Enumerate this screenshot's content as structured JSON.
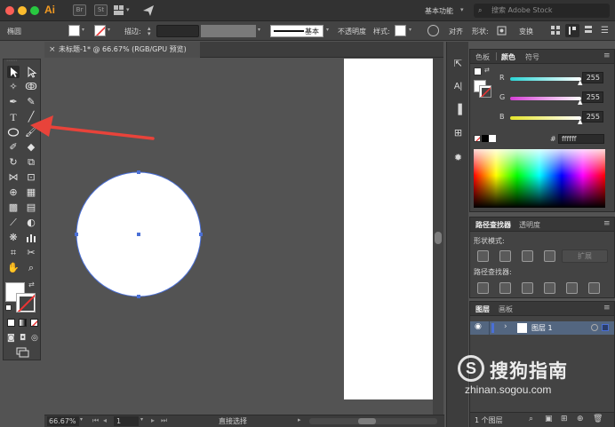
{
  "app": {
    "logo": "Ai",
    "bridge_label": "Br",
    "stock_label": "St",
    "workspace": "基本功能",
    "search_placeholder": "搜索 Adobe Stock"
  },
  "control_bar": {
    "object_type": "椭圆",
    "stroke_label": "描边:",
    "stroke_profile": "基本",
    "opacity_label": "不透明度",
    "style_label": "样式:",
    "align_label": "对齐",
    "shape_label": "形状:",
    "transform_label": "变换"
  },
  "document": {
    "tab_title": "未标题-1* @ 66.67% (RGB/GPU 预览)",
    "close_glyph": "×"
  },
  "status_bar": {
    "zoom": "66.67%",
    "artboard_number": "1",
    "current_tool": "直接选择"
  },
  "color_panel": {
    "tabs": [
      "色板",
      "颜色",
      "符号"
    ],
    "active_tab": "颜色",
    "channels": [
      {
        "name": "R",
        "value": "255",
        "color": "#ff4a4a"
      },
      {
        "name": "G",
        "value": "255",
        "color": "#48e04f"
      },
      {
        "name": "B",
        "value": "255",
        "color": "#4f6cf5"
      }
    ],
    "hex_label": "#",
    "hex_value": "ffffff"
  },
  "pathfinder_panel": {
    "tabs": [
      "路径查找器",
      "透明度"
    ],
    "shape_modes_label": "形状模式:",
    "expand_label": "扩展",
    "pathfinders_label": "路径查找器:"
  },
  "layers_panel": {
    "tabs": [
      "图层",
      "画板"
    ],
    "layer_name": "图层 1",
    "footer_count": "1 个图层"
  },
  "watermark": {
    "brand": "搜狗指南",
    "url": "zhinan.sogou.com"
  },
  "colors": {
    "accent_red": "#e8433a",
    "selection_blue": "#4a6fd6",
    "ai_orange": "#f29a22"
  }
}
